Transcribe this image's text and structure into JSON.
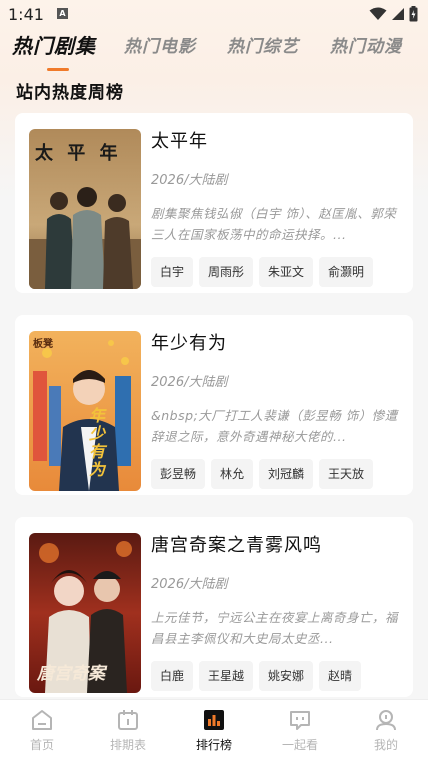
{
  "status": {
    "time": "1:41",
    "notif_letter": "A"
  },
  "tabs": [
    {
      "label": "热门剧集",
      "active": true
    },
    {
      "label": "热门电影",
      "active": false
    },
    {
      "label": "热门综艺",
      "active": false
    },
    {
      "label": "热门动漫",
      "active": false
    }
  ],
  "section_title": "站内热度周榜",
  "cards": [
    {
      "title": "太平年",
      "meta": "2026/大陆剧",
      "desc": "剧集聚焦钱弘俶（白宇 饰）、赵匡胤、郭荣三人在国家板荡中的命运抉择。...",
      "poster_text": "太 平 年",
      "tags": [
        "白宇",
        "周雨彤",
        "朱亚文",
        "俞灏明"
      ]
    },
    {
      "title": "年少有为",
      "meta": "2026/大陆剧",
      "desc": "&nbsp;大厂打工人裴谦（彭昱畅 饰）惨遭辞退之际，意外奇遇神秘大佬的...",
      "poster_text": "年少有为",
      "poster_badge": "板凳",
      "tags": [
        "彭昱畅",
        "林允",
        "刘冠麟",
        "王天放"
      ]
    },
    {
      "title": "唐宫奇案之青雾风鸣",
      "meta": "2026/大陆剧",
      "desc": "上元佳节，宁远公主在夜宴上离奇身亡，福昌县主李佩仪和大史局太史丞...",
      "poster_text": "唐宫奇案",
      "tags": [
        "白鹿",
        "王星越",
        "姚安娜",
        "赵晴"
      ]
    }
  ],
  "nav": [
    {
      "label": "首页",
      "icon": "home-icon",
      "active": false
    },
    {
      "label": "排期表",
      "icon": "calendar-icon",
      "active": false
    },
    {
      "label": "排行榜",
      "icon": "ranking-icon",
      "active": true
    },
    {
      "label": "一起看",
      "icon": "chat-icon",
      "active": false
    },
    {
      "label": "我的",
      "icon": "profile-icon",
      "active": false
    }
  ],
  "colors": {
    "accent": "#f07a2a",
    "active_nav": "#111111",
    "inactive_nav": "#b5b5b5"
  }
}
